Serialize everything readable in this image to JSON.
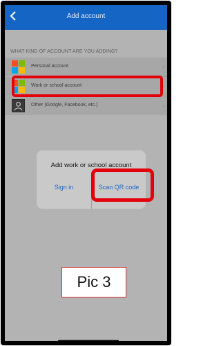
{
  "navbar": {
    "title": "Add account"
  },
  "section_header": "WHAT KIND OF ACCOUNT ARE YOU ADDING?",
  "accounts": [
    {
      "label": "Personal account",
      "icon": "microsoft-logo-icon"
    },
    {
      "label": "Work or school account",
      "icon": "microsoft-logo-icon"
    },
    {
      "label": "Other (Google, Facebook, etc.)",
      "icon": "person-icon"
    }
  ],
  "dialog": {
    "title": "Add work or school account",
    "sign_in_label": "Sign in",
    "scan_qr_label": "Scan QR code"
  },
  "caption": "Pic 3",
  "colors": {
    "header_blue": "#1565c4",
    "highlight_red": "#e3000b",
    "link_blue": "#1a66c7"
  }
}
